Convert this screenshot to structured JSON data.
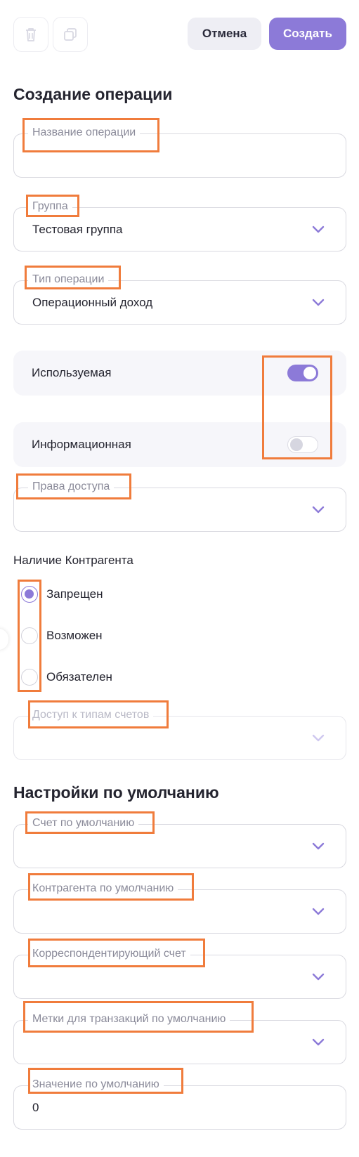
{
  "toolbar": {
    "delete_icon": "trash-icon",
    "copy_icon": "copy-icon",
    "cancel_label": "Отмена",
    "create_label": "Создать"
  },
  "title": "Создание операции",
  "fields": {
    "name": {
      "label": "Название операции",
      "value": ""
    },
    "group": {
      "label": "Группа",
      "value": "Тестовая группа"
    },
    "type": {
      "label": "Тип операции",
      "value": "Операционный доход"
    },
    "access_rights": {
      "label": "Права доступа",
      "value": ""
    },
    "account_types": {
      "label": "Доступ к типам счетов",
      "value": ""
    }
  },
  "toggles": {
    "used": {
      "label": "Используемая",
      "on": true
    },
    "info": {
      "label": "Информационная",
      "on": false
    }
  },
  "counterparty": {
    "label": "Наличие Контрагента",
    "options": [
      "Запрещен",
      "Возможен",
      "Обязателен"
    ],
    "selected": "Запрещен"
  },
  "defaults": {
    "title": "Настройки по умолчанию",
    "account": {
      "label": "Счет по умолчанию",
      "value": ""
    },
    "counterparty": {
      "label": "Контрагента по умолчанию",
      "value": ""
    },
    "corr_account": {
      "label": "Корреспондентирующий счет",
      "value": ""
    },
    "tags": {
      "label": "Метки для транзакций по умолчанию",
      "value": ""
    },
    "value": {
      "label": "Значение по умолчанию",
      "value": "0"
    }
  },
  "colors": {
    "accent": "#8c7ad8",
    "highlight": "#f07c3c"
  }
}
